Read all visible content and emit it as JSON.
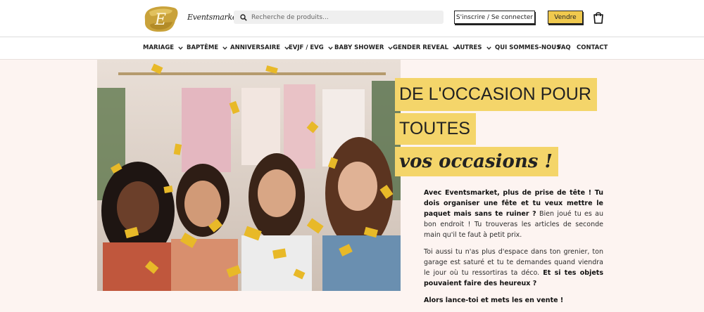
{
  "brand": {
    "name": "Eventsmarket",
    "logo_letter": "E"
  },
  "search": {
    "placeholder": "Recherche de produits..."
  },
  "header": {
    "signin_label": "S'inscrire / Se connecter",
    "sell_label": "Vendre"
  },
  "nav": {
    "items": [
      {
        "label": "MARIAGE",
        "dropdown": true
      },
      {
        "label": "BAPTÊME",
        "dropdown": true
      },
      {
        "label": "ANNIVERSAIRE",
        "dropdown": true
      },
      {
        "label": "EVJF / EVG",
        "dropdown": true
      },
      {
        "label": "BABY SHOWER",
        "dropdown": true
      },
      {
        "label": "GENDER REVEAL",
        "dropdown": true
      },
      {
        "label": "AUTRES",
        "dropdown": true
      },
      {
        "label": "QUI SOMMES-NOUS",
        "dropdown": false
      },
      {
        "label": "FAQ",
        "dropdown": false
      },
      {
        "label": "CONTACT",
        "dropdown": false
      }
    ]
  },
  "hero": {
    "line1": "DE L'OCCASION POUR",
    "line2": "TOUTES",
    "line3": "vos occasions !",
    "image_alt": "Quatre femmes soufflant des confettis dorés"
  },
  "intro": {
    "p1_bold": "Avec Eventsmarket, plus de prise de tête ! Tu dois organiser une fête et tu veux mettre le paquet mais sans te ruiner ?",
    "p1_rest": " Bien joué tu es au bon endroit ! Tu trouveras les articles de seconde main qu'il te faut à petit prix.",
    "p2_text": "Toi aussi tu n'as plus d'espace dans ton grenier, ton garage est saturé et tu te demandes quand viendra le jour où tu ressortiras ta déco. ",
    "p2_bold": "Et si tes objets pouvaient faire des heureux ?",
    "p3_bold": "Alors lance-toi et mets les en vente !"
  },
  "colors": {
    "accent": "#f4d56a",
    "button_sell": "#f0c94e",
    "background": "#fdf4f1"
  },
  "icons": {
    "search": "search-icon",
    "cart": "shopping-bag-icon",
    "chevron": "chevron-down-icon"
  }
}
